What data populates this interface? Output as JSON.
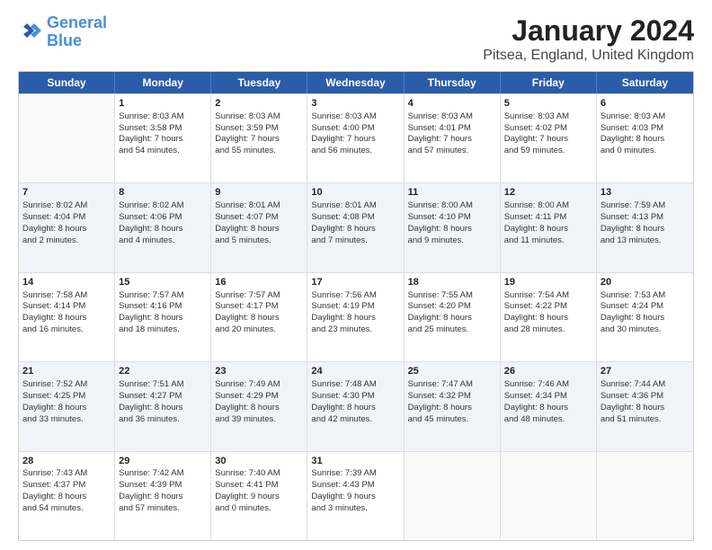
{
  "logo": {
    "line1": "General",
    "line2": "Blue"
  },
  "title": "January 2024",
  "subtitle": "Pitsea, England, United Kingdom",
  "headers": [
    "Sunday",
    "Monday",
    "Tuesday",
    "Wednesday",
    "Thursday",
    "Friday",
    "Saturday"
  ],
  "rows": [
    [
      {
        "day": "",
        "lines": []
      },
      {
        "day": "1",
        "lines": [
          "Sunrise: 8:03 AM",
          "Sunset: 3:58 PM",
          "Daylight: 7 hours",
          "and 54 minutes."
        ]
      },
      {
        "day": "2",
        "lines": [
          "Sunrise: 8:03 AM",
          "Sunset: 3:59 PM",
          "Daylight: 7 hours",
          "and 55 minutes."
        ]
      },
      {
        "day": "3",
        "lines": [
          "Sunrise: 8:03 AM",
          "Sunset: 4:00 PM",
          "Daylight: 7 hours",
          "and 56 minutes."
        ]
      },
      {
        "day": "4",
        "lines": [
          "Sunrise: 8:03 AM",
          "Sunset: 4:01 PM",
          "Daylight: 7 hours",
          "and 57 minutes."
        ]
      },
      {
        "day": "5",
        "lines": [
          "Sunrise: 8:03 AM",
          "Sunset: 4:02 PM",
          "Daylight: 7 hours",
          "and 59 minutes."
        ]
      },
      {
        "day": "6",
        "lines": [
          "Sunrise: 8:03 AM",
          "Sunset: 4:03 PM",
          "Daylight: 8 hours",
          "and 0 minutes."
        ]
      }
    ],
    [
      {
        "day": "7",
        "lines": [
          "Sunrise: 8:02 AM",
          "Sunset: 4:04 PM",
          "Daylight: 8 hours",
          "and 2 minutes."
        ]
      },
      {
        "day": "8",
        "lines": [
          "Sunrise: 8:02 AM",
          "Sunset: 4:06 PM",
          "Daylight: 8 hours",
          "and 4 minutes."
        ]
      },
      {
        "day": "9",
        "lines": [
          "Sunrise: 8:01 AM",
          "Sunset: 4:07 PM",
          "Daylight: 8 hours",
          "and 5 minutes."
        ]
      },
      {
        "day": "10",
        "lines": [
          "Sunrise: 8:01 AM",
          "Sunset: 4:08 PM",
          "Daylight: 8 hours",
          "and 7 minutes."
        ]
      },
      {
        "day": "11",
        "lines": [
          "Sunrise: 8:00 AM",
          "Sunset: 4:10 PM",
          "Daylight: 8 hours",
          "and 9 minutes."
        ]
      },
      {
        "day": "12",
        "lines": [
          "Sunrise: 8:00 AM",
          "Sunset: 4:11 PM",
          "Daylight: 8 hours",
          "and 11 minutes."
        ]
      },
      {
        "day": "13",
        "lines": [
          "Sunrise: 7:59 AM",
          "Sunset: 4:13 PM",
          "Daylight: 8 hours",
          "and 13 minutes."
        ]
      }
    ],
    [
      {
        "day": "14",
        "lines": [
          "Sunrise: 7:58 AM",
          "Sunset: 4:14 PM",
          "Daylight: 8 hours",
          "and 16 minutes."
        ]
      },
      {
        "day": "15",
        "lines": [
          "Sunrise: 7:57 AM",
          "Sunset: 4:16 PM",
          "Daylight: 8 hours",
          "and 18 minutes."
        ]
      },
      {
        "day": "16",
        "lines": [
          "Sunrise: 7:57 AM",
          "Sunset: 4:17 PM",
          "Daylight: 8 hours",
          "and 20 minutes."
        ]
      },
      {
        "day": "17",
        "lines": [
          "Sunrise: 7:56 AM",
          "Sunset: 4:19 PM",
          "Daylight: 8 hours",
          "and 23 minutes."
        ]
      },
      {
        "day": "18",
        "lines": [
          "Sunrise: 7:55 AM",
          "Sunset: 4:20 PM",
          "Daylight: 8 hours",
          "and 25 minutes."
        ]
      },
      {
        "day": "19",
        "lines": [
          "Sunrise: 7:54 AM",
          "Sunset: 4:22 PM",
          "Daylight: 8 hours",
          "and 28 minutes."
        ]
      },
      {
        "day": "20",
        "lines": [
          "Sunrise: 7:53 AM",
          "Sunset: 4:24 PM",
          "Daylight: 8 hours",
          "and 30 minutes."
        ]
      }
    ],
    [
      {
        "day": "21",
        "lines": [
          "Sunrise: 7:52 AM",
          "Sunset: 4:25 PM",
          "Daylight: 8 hours",
          "and 33 minutes."
        ]
      },
      {
        "day": "22",
        "lines": [
          "Sunrise: 7:51 AM",
          "Sunset: 4:27 PM",
          "Daylight: 8 hours",
          "and 36 minutes."
        ]
      },
      {
        "day": "23",
        "lines": [
          "Sunrise: 7:49 AM",
          "Sunset: 4:29 PM",
          "Daylight: 8 hours",
          "and 39 minutes."
        ]
      },
      {
        "day": "24",
        "lines": [
          "Sunrise: 7:48 AM",
          "Sunset: 4:30 PM",
          "Daylight: 8 hours",
          "and 42 minutes."
        ]
      },
      {
        "day": "25",
        "lines": [
          "Sunrise: 7:47 AM",
          "Sunset: 4:32 PM",
          "Daylight: 8 hours",
          "and 45 minutes."
        ]
      },
      {
        "day": "26",
        "lines": [
          "Sunrise: 7:46 AM",
          "Sunset: 4:34 PM",
          "Daylight: 8 hours",
          "and 48 minutes."
        ]
      },
      {
        "day": "27",
        "lines": [
          "Sunrise: 7:44 AM",
          "Sunset: 4:36 PM",
          "Daylight: 8 hours",
          "and 51 minutes."
        ]
      }
    ],
    [
      {
        "day": "28",
        "lines": [
          "Sunrise: 7:43 AM",
          "Sunset: 4:37 PM",
          "Daylight: 8 hours",
          "and 54 minutes."
        ]
      },
      {
        "day": "29",
        "lines": [
          "Sunrise: 7:42 AM",
          "Sunset: 4:39 PM",
          "Daylight: 8 hours",
          "and 57 minutes."
        ]
      },
      {
        "day": "30",
        "lines": [
          "Sunrise: 7:40 AM",
          "Sunset: 4:41 PM",
          "Daylight: 9 hours",
          "and 0 minutes."
        ]
      },
      {
        "day": "31",
        "lines": [
          "Sunrise: 7:39 AM",
          "Sunset: 4:43 PM",
          "Daylight: 9 hours",
          "and 3 minutes."
        ]
      },
      {
        "day": "",
        "lines": []
      },
      {
        "day": "",
        "lines": []
      },
      {
        "day": "",
        "lines": []
      }
    ]
  ]
}
